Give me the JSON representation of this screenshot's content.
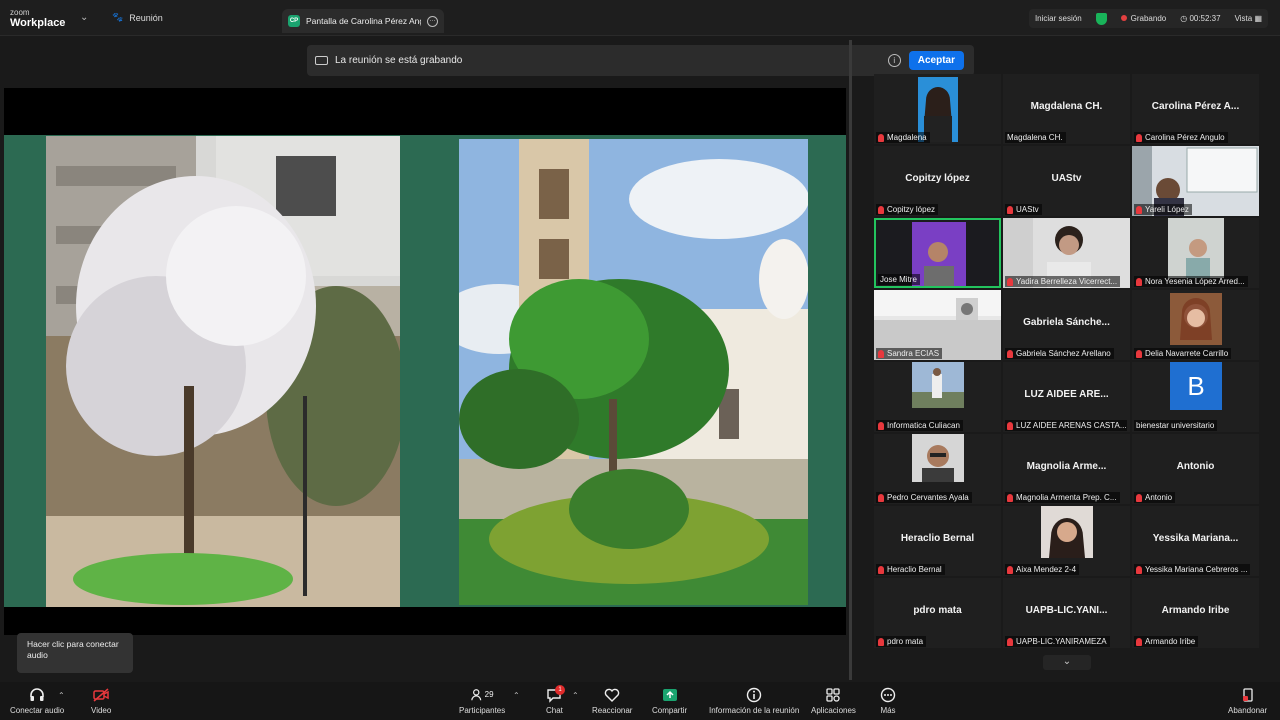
{
  "app": {
    "brand_line1": "zoom",
    "brand_line2": "Workplace"
  },
  "topbar": {
    "meeting_tab": "Reunión",
    "share_tab": {
      "badge": "CP",
      "title": "Pantalla de Carolina Pérez Angulo"
    },
    "sign_in": "Iniciar sesión",
    "recording": "Grabando",
    "timer": "00:52:37",
    "view": "Vista"
  },
  "banner": {
    "text": "La reunión se está grabando",
    "accept": "Aceptar"
  },
  "gallery": [
    {
      "big": "",
      "label": "Magdalena",
      "muted": true,
      "video": "woman-glasses-blue"
    },
    {
      "big": "Magdalena CH.",
      "label": "Magdalena CH.",
      "muted": false
    },
    {
      "big": "Carolina Pérez A...",
      "label": "Carolina Pérez Angulo",
      "muted": true
    },
    {
      "big": "Copitzy lópez",
      "label": "Copitzy lópez",
      "muted": true
    },
    {
      "big": "UAStv",
      "label": "UAStv",
      "muted": true
    },
    {
      "big": "",
      "label": "Yareli López",
      "muted": true,
      "video": "office-whiteboard"
    },
    {
      "big": "",
      "label": "Jose Mitre",
      "muted": false,
      "video": "man-purple-light",
      "active": true
    },
    {
      "big": "",
      "label": "Yadira Berrelleza Vicerrect...",
      "muted": true,
      "video": "woman-desk"
    },
    {
      "big": "",
      "label": "Nora Yesenia López Arred...",
      "muted": true,
      "video": "woman-room"
    },
    {
      "big": "",
      "label": "Sandra ECIAS",
      "muted": true,
      "video": "ceiling-fan"
    },
    {
      "big": "Gabriela  Sánche...",
      "label": "Gabriela Sánchez Arellano",
      "muted": true
    },
    {
      "big": "",
      "label": "Delia Navarrete Carrillo",
      "muted": true,
      "video": "woman-portrait"
    },
    {
      "big": "",
      "label": "Informatica Culiacan",
      "muted": true,
      "video": "person-outdoor"
    },
    {
      "big": "LUZ AIDEE ARE...",
      "label": "LUZ AIDEE ARENAS CASTA...",
      "muted": true
    },
    {
      "big": "",
      "label": "bienestar universitario",
      "muted": false,
      "video": "blue-b-logo",
      "logo_letter": "B"
    },
    {
      "big": "",
      "label": "Pedro Cervantes Ayala",
      "muted": true,
      "video": "man-glasses"
    },
    {
      "big": "Magnolia  Arme...",
      "label": "Magnolia Armenta Prep. C...",
      "muted": true
    },
    {
      "big": "Antonio",
      "label": "Antonio",
      "muted": true
    },
    {
      "big": "Heraclio Bernal",
      "label": "Heraclio Bernal",
      "muted": true
    },
    {
      "big": "",
      "label": "Aixa Mendez 2-4",
      "muted": true,
      "video": "woman-dark-hair"
    },
    {
      "big": "Yessika  Mariana...",
      "label": "Yessika Mariana Cebreros ...",
      "muted": true
    },
    {
      "big": "pdro mata",
      "label": "pdro mata",
      "muted": true
    },
    {
      "big": "UAPB-LIC.YANI...",
      "label": "UAPB-LIC.YANIRAMEZA",
      "muted": true
    },
    {
      "big": "Armando Iribe",
      "label": "Armando Iribe",
      "muted": true
    }
  ],
  "tooltip": "Hacer clic para conectar audio",
  "toolbar": {
    "audio": "Conectar audio",
    "video": "Video",
    "participants": "Participantes",
    "participants_count": "29",
    "chat": "Chat",
    "chat_badge": "1",
    "react": "Reaccionar",
    "share": "Compartir",
    "info": "Información de la reunión",
    "apps": "Aplicaciones",
    "more": "Más",
    "leave": "Abandonar"
  },
  "colors": {
    "accent": "#0e71eb",
    "share_green": "#1aa36f",
    "slide_bg": "#2c6a52",
    "muted_red": "#e8383d",
    "active_border": "#23c45e"
  }
}
